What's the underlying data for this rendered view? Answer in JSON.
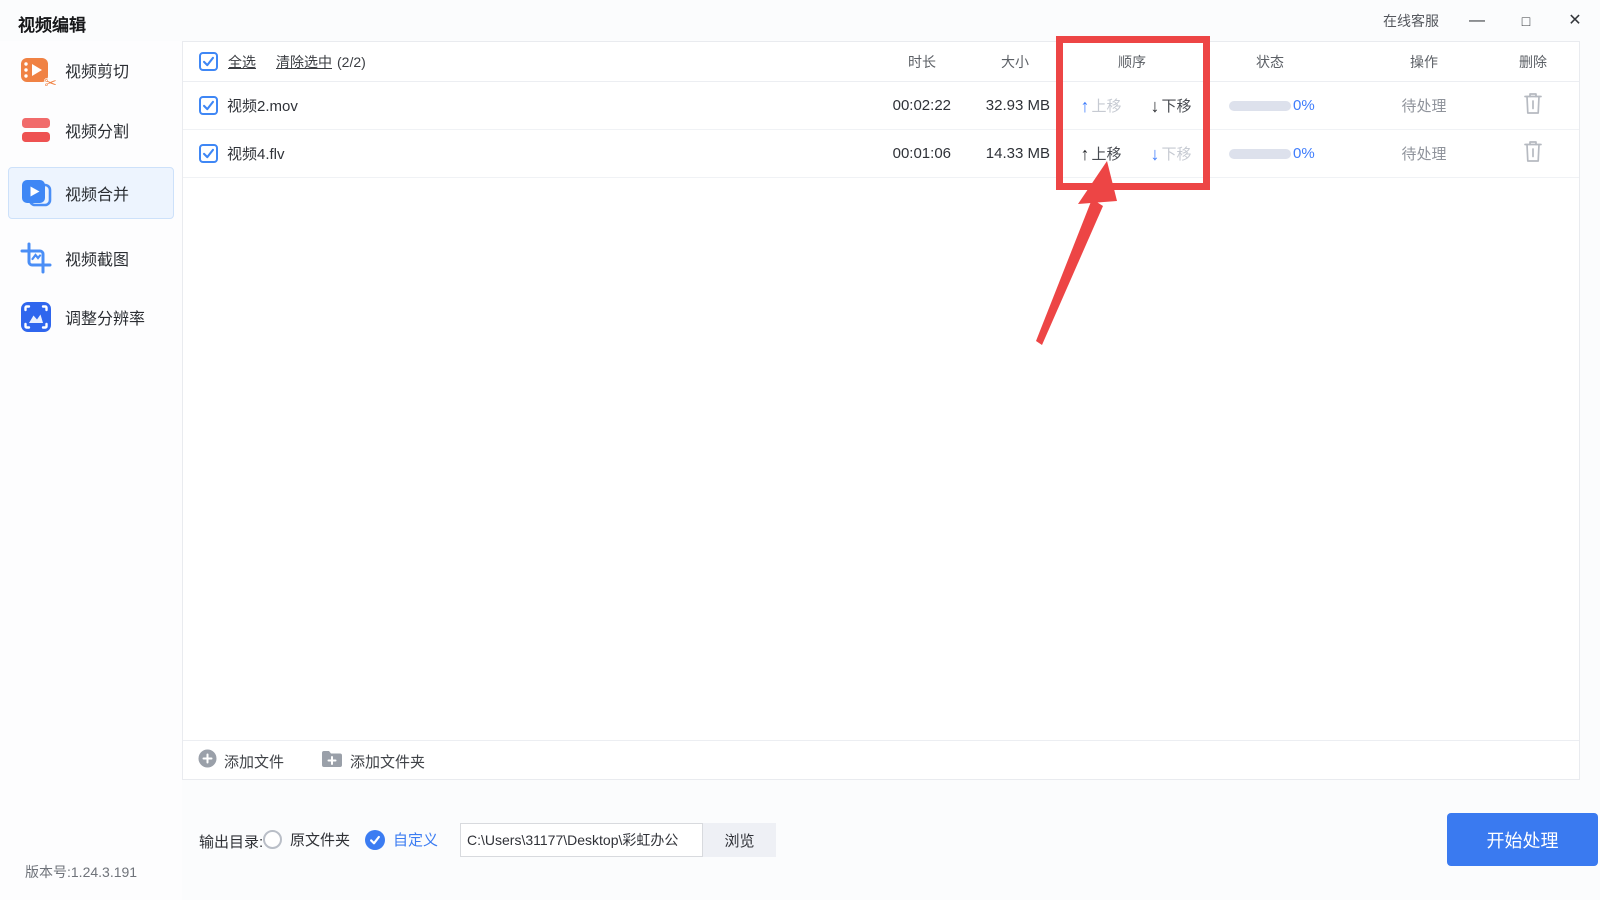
{
  "window": {
    "title": "视频编辑",
    "online_service": "在线客服"
  },
  "icons": {
    "minimize": "—",
    "maximize": "□",
    "close": "✕",
    "scissors": "✂",
    "move_up_arrow": "↑",
    "move_down_arrow": "↓"
  },
  "colors": {
    "accent_blue": "#3b7cf2",
    "annotation_red": "#ed4545",
    "disabled_gray": "#c6cad2",
    "progress_track": "#dde1ec"
  },
  "sidebar": {
    "items": [
      {
        "label": "视频剪切",
        "icon": "video-cut-icon",
        "active": false
      },
      {
        "label": "视频分割",
        "icon": "video-split-icon",
        "active": false
      },
      {
        "label": "视频合并",
        "icon": "video-merge-icon",
        "active": true
      },
      {
        "label": "视频截图",
        "icon": "video-screenshot-icon",
        "active": false
      },
      {
        "label": "调整分辨率",
        "icon": "adjust-resolution-icon",
        "active": false
      }
    ]
  },
  "list": {
    "select_all": "全选",
    "clear_selected": "清除选中",
    "selected_count": "(2/2)",
    "headers": {
      "duration": "时长",
      "size": "大小",
      "order": "顺序",
      "status": "状态",
      "operation": "操作",
      "delete": "删除"
    },
    "order_actions": {
      "up": "上移",
      "down": "下移"
    },
    "rows": [
      {
        "name": "视频2.mov",
        "duration": "00:02:22",
        "size": "32.93 MB",
        "up_disabled": true,
        "down_disabled": false,
        "progress": "0%",
        "status": "待处理"
      },
      {
        "name": "视频4.flv",
        "duration": "00:01:06",
        "size": "14.33 MB",
        "up_disabled": false,
        "down_disabled": true,
        "progress": "0%",
        "status": "待处理"
      }
    ]
  },
  "footer": {
    "add_file": "添加文件",
    "add_folder": "添加文件夹"
  },
  "output": {
    "label": "输出目录:",
    "original_folder": "原文件夹",
    "custom": "自定义",
    "path": "C:\\Users\\31177\\Desktop\\彩虹办公",
    "browse": "浏览",
    "start": "开始处理"
  },
  "version": "版本号:1.24.3.191"
}
